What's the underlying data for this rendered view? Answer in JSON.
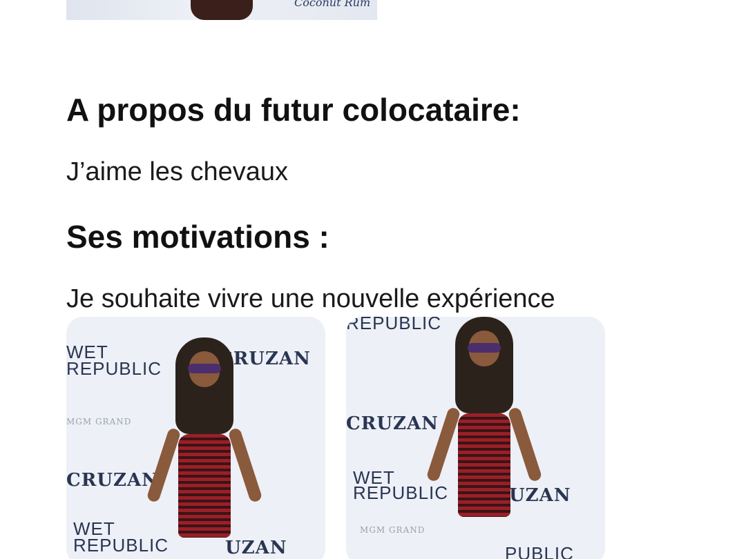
{
  "top_photo": {
    "alt_icon": "photo-icon",
    "watermark_text": "Coconut Rum"
  },
  "sections": {
    "about": {
      "heading": "A propos du futur colocataire:",
      "body": "J’aime les chevaux"
    },
    "motivations": {
      "heading": "Ses motivations :",
      "body": "Je souhaite vivre une nouvelle expérience"
    }
  },
  "gallery": {
    "photo_1": {
      "logos": [
        "WET",
        "REPUBLIC",
        "CRUZAN",
        "MGM GRAND",
        "CRUZAN",
        "WET",
        "REPUBLIC",
        "UZAN"
      ]
    },
    "photo_2": {
      "logos": [
        "REPUBLIC",
        "CRUZAN",
        "WET",
        "REPUBLIC",
        "UZAN",
        "MGM GRAND",
        "PUBLIC"
      ]
    }
  },
  "colors": {
    "text": "#111111",
    "background": "#ffffff",
    "backdrop": "#edf0f6",
    "dress": "#9b1f27"
  }
}
